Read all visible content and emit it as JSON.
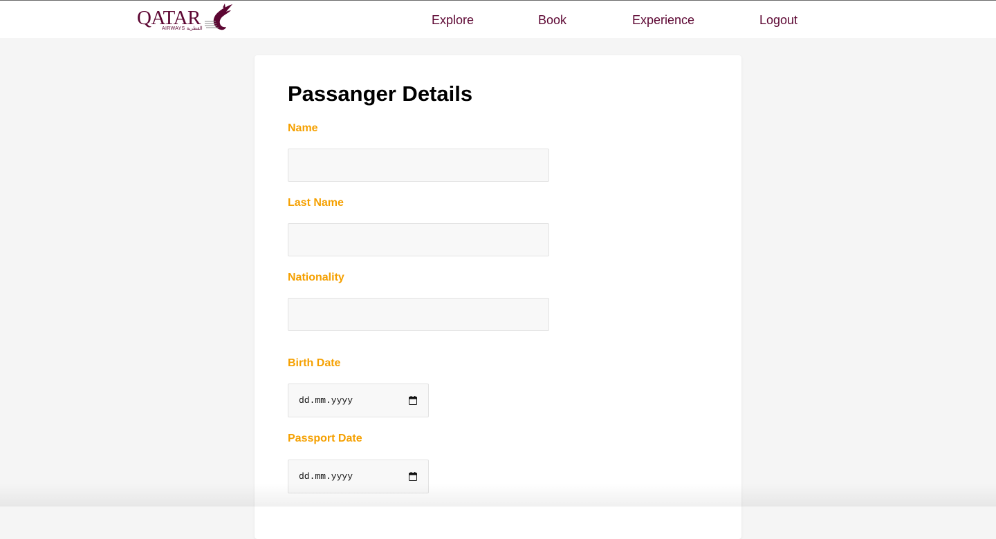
{
  "header": {
    "logo": {
      "wordmark": "QATAR",
      "subtext": "AIRWAYS القطرية",
      "brand_color": "#5c0632",
      "icon": "oryx-logo-icon"
    },
    "nav": [
      {
        "label": "Explore"
      },
      {
        "label": "Book"
      },
      {
        "label": "Experience"
      },
      {
        "label": "Logout"
      }
    ]
  },
  "form": {
    "title": "Passanger Details",
    "label_color": "#f5a000",
    "fields": {
      "name": {
        "label": "Name",
        "value": "",
        "placeholder": ""
      },
      "last_name": {
        "label": "Last Name",
        "value": "",
        "placeholder": ""
      },
      "nationality": {
        "label": "Nationality",
        "value": "",
        "placeholder": ""
      },
      "birth_date": {
        "label": "Birth Date",
        "placeholder": "dd.mm.yyyy",
        "icon": "calendar-icon"
      },
      "passport_date": {
        "label": "Passport Date",
        "placeholder": "dd.mm.yyyy",
        "icon": "calendar-icon"
      }
    }
  }
}
